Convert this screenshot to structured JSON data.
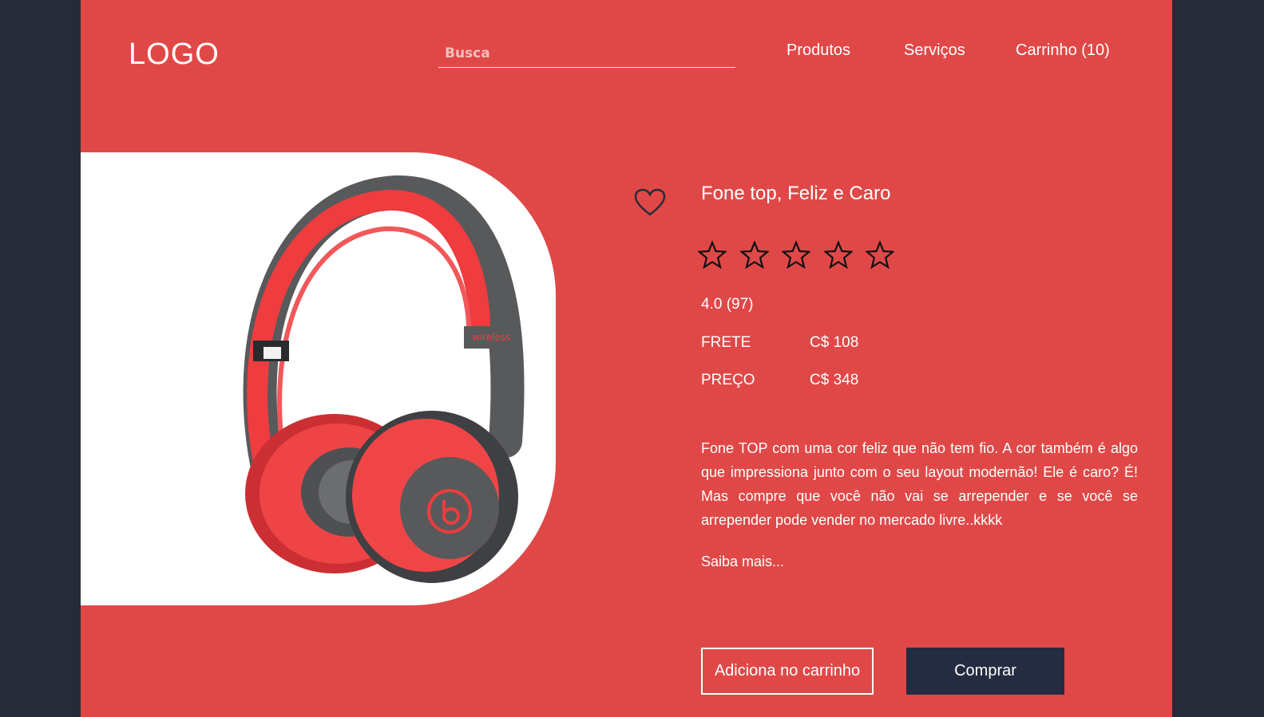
{
  "header": {
    "logo": "LOGO",
    "search_placeholder": "Busca",
    "nav": {
      "products": "Produtos",
      "services": "Serviços",
      "cart": "Carrinho (10)"
    }
  },
  "product": {
    "image_alt": "beats wireless headphones",
    "image_brand_text": "wireless",
    "title": "Fone top, Feliz e Caro",
    "rating_text": "4.0 (97)",
    "stars_total": 5,
    "shipping": {
      "label": "FRETE",
      "value": "C$ 108"
    },
    "price": {
      "label": "PREÇO",
      "value": "C$ 348"
    },
    "description": "Fone TOP com uma cor feliz que não tem fio. A cor também é algo que impressiona junto com o seu layout modernão! Ele é caro? É! Mas compre que você não vai se arrepender e se você se arrepender pode vender no mercado livre..kkkk",
    "read_more": "Saiba mais..."
  },
  "actions": {
    "add_to_cart": "Adiciona no carrinho",
    "buy": "Comprar"
  },
  "icons": {
    "favorite": "heart-icon",
    "rating": "star-icon"
  },
  "colors": {
    "background": "#e04848",
    "outer": "#252b38",
    "buy_button": "#252b40",
    "text": "#ffffff"
  }
}
